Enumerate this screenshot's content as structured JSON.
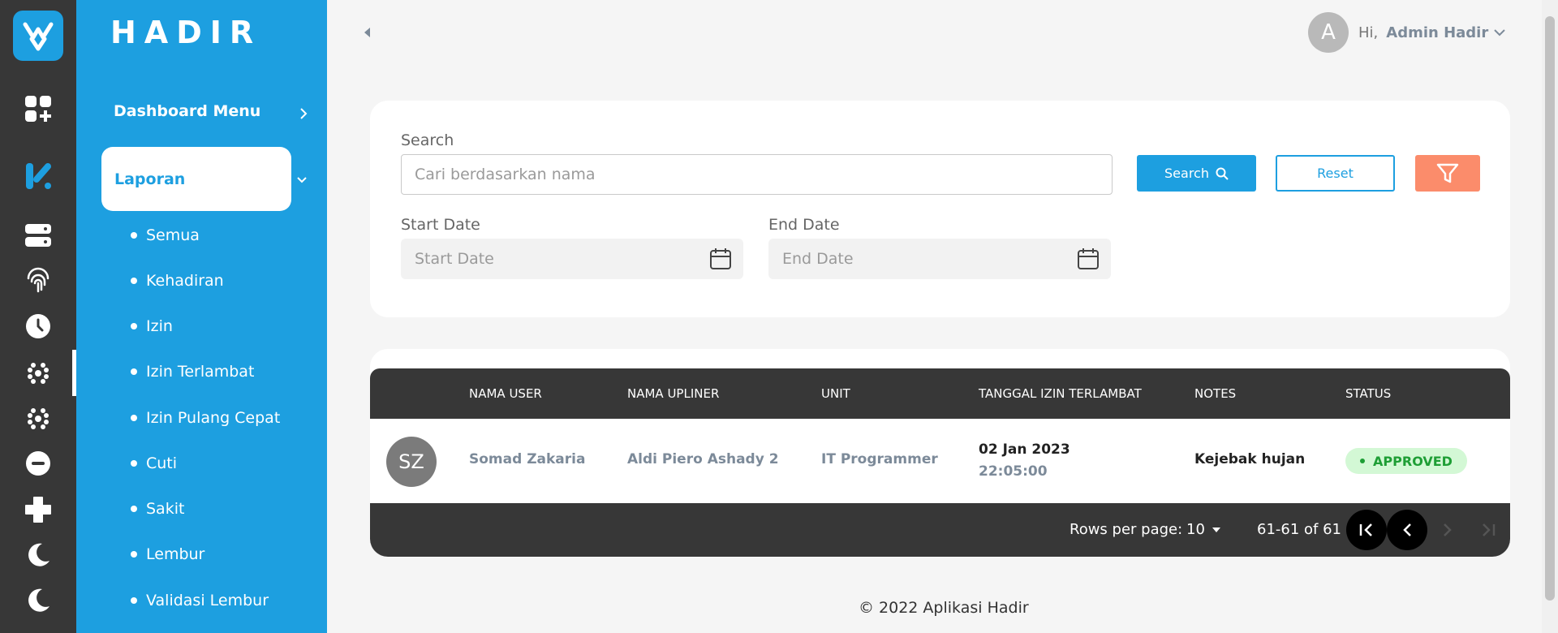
{
  "app": {
    "brand": "HADIR"
  },
  "rail": {
    "icons": [
      "apps-add-icon",
      "leave-icon",
      "server-icon",
      "fingerprint-icon",
      "clock-icon",
      "network-icon",
      "network-icon",
      "minus-circle-icon",
      "plus-icon",
      "moon-icon",
      "moon-icon"
    ]
  },
  "sidebar": {
    "dashboard_menu": "Dashboard Menu",
    "laporan": "Laporan",
    "items": [
      {
        "label": "Semua"
      },
      {
        "label": "Kehadiran"
      },
      {
        "label": "Izin"
      },
      {
        "label": "Izin Terlambat"
      },
      {
        "label": "Izin Pulang Cepat"
      },
      {
        "label": "Cuti"
      },
      {
        "label": "Sakit"
      },
      {
        "label": "Lembur"
      },
      {
        "label": "Validasi Lembur"
      }
    ]
  },
  "header": {
    "avatar_initial": "A",
    "greeting": "Hi,",
    "user_name": "Admin Hadir"
  },
  "filter": {
    "search_label": "Search",
    "search_placeholder": "Cari berdasarkan nama",
    "search_value": "",
    "search_button": "Search",
    "reset_button": "Reset",
    "start_label": "Start Date",
    "start_placeholder": "Start Date",
    "end_label": "End Date",
    "end_placeholder": "End Date"
  },
  "table": {
    "columns": [
      "NAMA USER",
      "NAMA UPLINER",
      "UNIT",
      "TANGGAL IZIN TERLAMBAT",
      "NOTES",
      "STATUS"
    ],
    "rows": [
      {
        "initials": "SZ",
        "nama_user": "Somad Zakaria",
        "nama_upliner": "Aldi Piero Ashady 2",
        "unit": "IT Programmer",
        "tanggal": "02 Jan 2023",
        "jam": "22:05:00",
        "notes": "Kejebak hujan",
        "status": "APPROVED"
      }
    ],
    "footer": {
      "rows_per_page_label": "Rows per page:",
      "rows_per_page": "10",
      "range": "61-61 of 61"
    }
  },
  "footer": {
    "copyright": "© 2022 Aplikasi Hadir"
  },
  "colors": {
    "primary": "#1d9fe0",
    "rail": "#373737",
    "filter_button": "#fb8c6b",
    "approved_bg": "#d3f8d5",
    "approved_text": "#1e9e35"
  }
}
